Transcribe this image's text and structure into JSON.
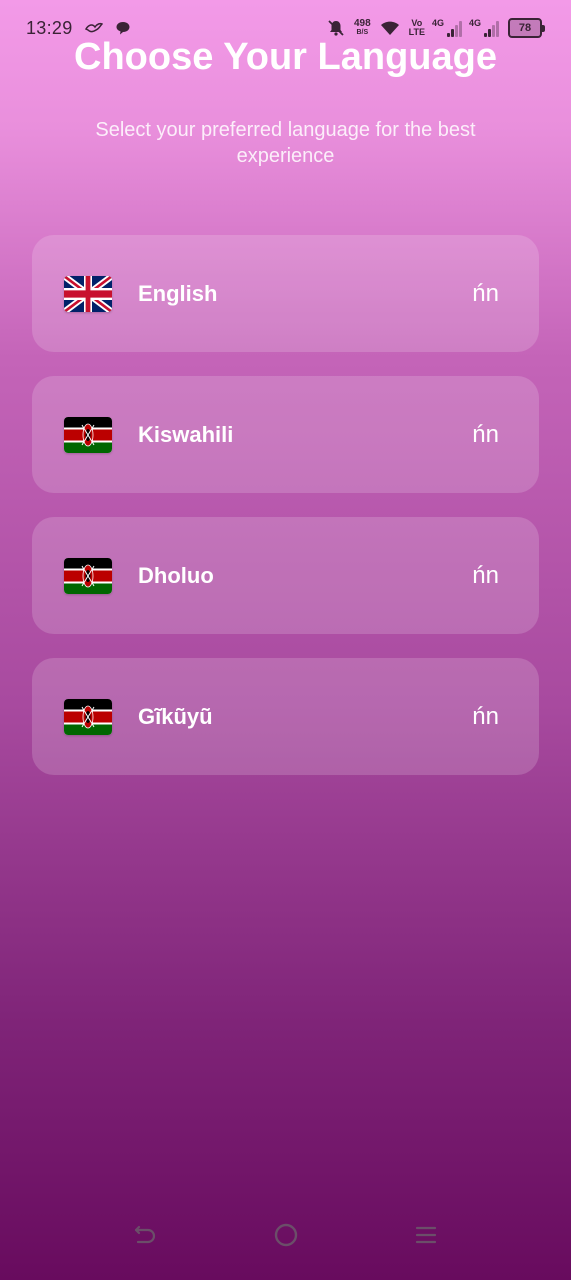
{
  "status_bar": {
    "time": "13:29",
    "net_speed_value": "498",
    "net_speed_unit": "B/S",
    "volte_top": "Vo",
    "volte_bottom": "LTE",
    "signal1_label": "4G",
    "signal2_label": "4G",
    "battery": "78",
    "icons": [
      "bird-icon",
      "chat-bubble-icon",
      "bell-muted-icon",
      "wifi-icon",
      "signal-icon",
      "battery-icon"
    ]
  },
  "header": {
    "title": "Choose Your Language",
    "subtitle": "Select your preferred language for the best experience"
  },
  "languages": [
    {
      "flag": "uk-flag-icon",
      "name": "English",
      "code": "ńn"
    },
    {
      "flag": "kenya-flag-icon",
      "name": "Kiswahili",
      "code": "ńn"
    },
    {
      "flag": "kenya-flag-icon",
      "name": "Dholuo",
      "code": "ńn"
    },
    {
      "flag": "kenya-flag-icon",
      "name": "Gĩkũyũ",
      "code": "ńn"
    }
  ],
  "nav_bar": {
    "icons": [
      "back-icon",
      "home-icon",
      "menu-icon"
    ]
  },
  "colors": {
    "gradient_top": "#f39ae8",
    "gradient_bottom": "#680b5e",
    "card_background": "rgba(255,255,255,0.17)"
  }
}
